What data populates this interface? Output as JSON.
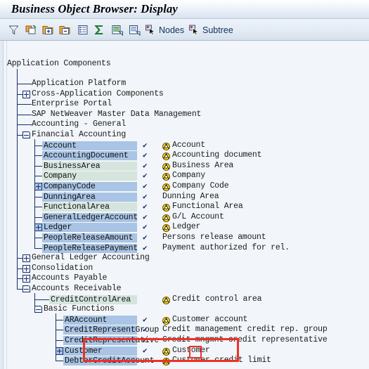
{
  "window": {
    "title": "Business Object Browser: Display"
  },
  "toolbar": {
    "buttons": [
      {
        "name": "filter",
        "icon": "filter-icon",
        "label": ""
      },
      {
        "name": "new-window",
        "icon": "new-window-icon",
        "label": ""
      },
      {
        "name": "expand-node",
        "icon": "expand-node-icon",
        "label": ""
      },
      {
        "name": "collapse-node",
        "icon": "collapse-node-icon",
        "label": ""
      },
      {
        "name": "detail-list",
        "icon": "detail-list-icon",
        "label": ""
      },
      {
        "name": "totals",
        "icon": "sigma-icon",
        "label": ""
      },
      {
        "name": "sort-list",
        "icon": "sort-list-icon",
        "label": ""
      },
      {
        "name": "print-preview",
        "icon": "document-icon",
        "label": ""
      },
      {
        "name": "nodes",
        "icon": "select-cursor-icon",
        "label": "Nodes"
      },
      {
        "name": "subtree",
        "icon": "select-cursor-icon",
        "label": "Subtree"
      }
    ],
    "nodes_label": "Nodes",
    "subtree_label": "Subtree"
  },
  "tree": {
    "root_label": "Application Components",
    "nodes": [
      {
        "label": "Application Platform",
        "highlight": "none",
        "check": false,
        "ball": false,
        "desc": "",
        "expander": "none"
      },
      {
        "label": "Cross-Application Components",
        "highlight": "none",
        "check": false,
        "ball": false,
        "desc": "",
        "expander": "plus"
      },
      {
        "label": "Enterprise Portal",
        "highlight": "none",
        "check": false,
        "ball": false,
        "desc": "",
        "expander": "none"
      },
      {
        "label": "SAP NetWeaver Master Data Management",
        "highlight": "none",
        "check": false,
        "ball": false,
        "desc": "",
        "expander": "none"
      },
      {
        "label": "Accounting - General",
        "highlight": "none",
        "check": false,
        "ball": false,
        "desc": "",
        "expander": "none"
      },
      {
        "label": "Financial Accounting",
        "highlight": "none",
        "check": false,
        "ball": false,
        "desc": "",
        "expander": "minus"
      },
      {
        "label": "Account",
        "highlight": "blue",
        "check": true,
        "ball": true,
        "desc": "Account",
        "expander": "none"
      },
      {
        "label": "AccountingDocument",
        "highlight": "blue",
        "check": true,
        "ball": true,
        "desc": "Accounting document",
        "expander": "none"
      },
      {
        "label": "BusinessArea",
        "highlight": "green",
        "check": true,
        "ball": true,
        "desc": "Business Area",
        "expander": "none"
      },
      {
        "label": "Company",
        "highlight": "green",
        "check": true,
        "ball": true,
        "desc": "Company",
        "expander": "none"
      },
      {
        "label": "CompanyCode",
        "highlight": "blue",
        "check": true,
        "ball": true,
        "desc": "Company Code",
        "expander": "plus"
      },
      {
        "label": "DunningArea",
        "highlight": "blue",
        "check": true,
        "ball": false,
        "desc": "Dunning Area",
        "expander": "none"
      },
      {
        "label": "FunctionalArea",
        "highlight": "green",
        "check": true,
        "ball": true,
        "desc": "Functional Area",
        "expander": "none"
      },
      {
        "label": "GeneralLedgerAccount",
        "highlight": "blue",
        "check": true,
        "ball": true,
        "desc": "G/L Account",
        "expander": "none"
      },
      {
        "label": "Ledger",
        "highlight": "blue",
        "check": true,
        "ball": true,
        "desc": "Ledger",
        "expander": "plus"
      },
      {
        "label": "PeopleReleaseAmount",
        "highlight": "blue",
        "check": true,
        "ball": false,
        "desc": "Persons release amount",
        "expander": "none"
      },
      {
        "label": "PeopleReleasePayment",
        "highlight": "blue",
        "check": true,
        "ball": false,
        "desc": "Payment authorized for rel.",
        "expander": "none"
      },
      {
        "label": "General Ledger Accounting",
        "highlight": "none",
        "check": false,
        "ball": false,
        "desc": "",
        "expander": "plus"
      },
      {
        "label": "Consolidation",
        "highlight": "none",
        "check": false,
        "ball": false,
        "desc": "",
        "expander": "plus"
      },
      {
        "label": "Accounts Payable",
        "highlight": "none",
        "check": false,
        "ball": false,
        "desc": "",
        "expander": "plus"
      },
      {
        "label": "Accounts Receivable",
        "highlight": "none",
        "check": false,
        "ball": false,
        "desc": "",
        "expander": "minus"
      },
      {
        "label": "CreditControlArea",
        "highlight": "green",
        "check": false,
        "ball": true,
        "desc": "Credit control area",
        "expander": "none"
      },
      {
        "label": "Basic Functions",
        "highlight": "none",
        "check": false,
        "ball": false,
        "desc": "",
        "expander": "minus"
      },
      {
        "label": "ARAccount",
        "highlight": "blue",
        "check": true,
        "ball": true,
        "desc": "Customer account",
        "expander": "none"
      },
      {
        "label": "CreditRepresentGroup",
        "highlight": "blue",
        "check": true,
        "ball": false,
        "desc": "Credit management credit rep. group",
        "expander": "none"
      },
      {
        "label": "CreditRepresentative",
        "highlight": "blue",
        "check": true,
        "ball": false,
        "desc": "Credit mngmnt credit representative",
        "expander": "none"
      },
      {
        "label": "Customer",
        "highlight": "blue",
        "check": true,
        "ball": true,
        "desc": "Customer",
        "expander": "plus"
      },
      {
        "label": "DebtorCreditAccount",
        "highlight": "blue",
        "check": true,
        "ball": true,
        "desc": "Customer credit limit",
        "expander": "none"
      }
    ]
  },
  "annotations": {
    "outer_box_color": "#f03024",
    "inner_box_color": "#f03024"
  },
  "colors": {
    "highlight_blue": "#a9c4e4",
    "highlight_green": "#d5e5dd",
    "tree_line": "#16306b",
    "panel_bg": "#f2f5f9",
    "title_text": "#000000"
  }
}
